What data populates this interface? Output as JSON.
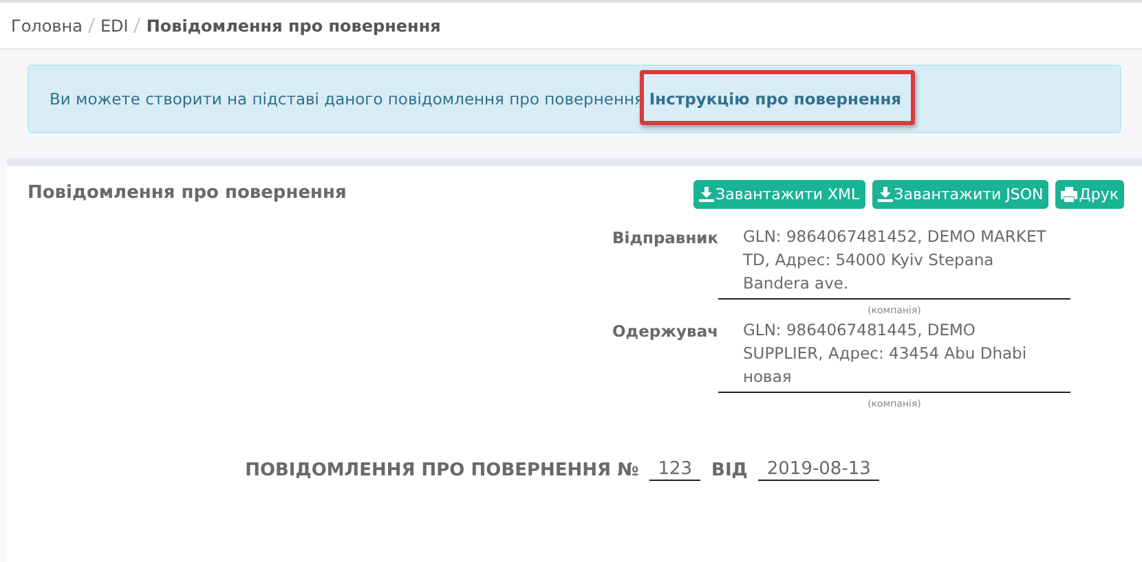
{
  "breadcrumbs": [
    {
      "label": "Головна",
      "current": false
    },
    {
      "label": "EDI",
      "current": false
    },
    {
      "label": "Повідомлення про повернення",
      "current": true
    }
  ],
  "alert": {
    "text": "Ви можете створити на підставі даного повідомлення про повернення",
    "link": "Інструкцію про повернення",
    "highlighted": true
  },
  "card": {
    "title": "Повідомлення про повернення",
    "buttons": [
      {
        "label": "Завантажити XML",
        "kind": "download"
      },
      {
        "label": "Завантажити JSON",
        "kind": "download"
      },
      {
        "label": "Друк",
        "kind": "print"
      }
    ],
    "parties": [
      {
        "label": "Відправник",
        "value": "GLN: 9864067481452, DEMO MARKET TD, Адрес: 54000 Kyiv Stepana Bandera ave.",
        "caption": "(компанія)"
      },
      {
        "label": "Одержувач",
        "value": "GLN: 9864067481445, DEMO SUPPLIER, Адрес: 43454 Abu Dhabi новая",
        "caption": "(компанія)"
      }
    ],
    "heading": {
      "title": "ПОВІДОМЛЕННЯ ПРО ПОВЕРНЕННЯ №",
      "number": "123",
      "date_label": "ВІД",
      "date": "2019-08-13"
    }
  }
}
